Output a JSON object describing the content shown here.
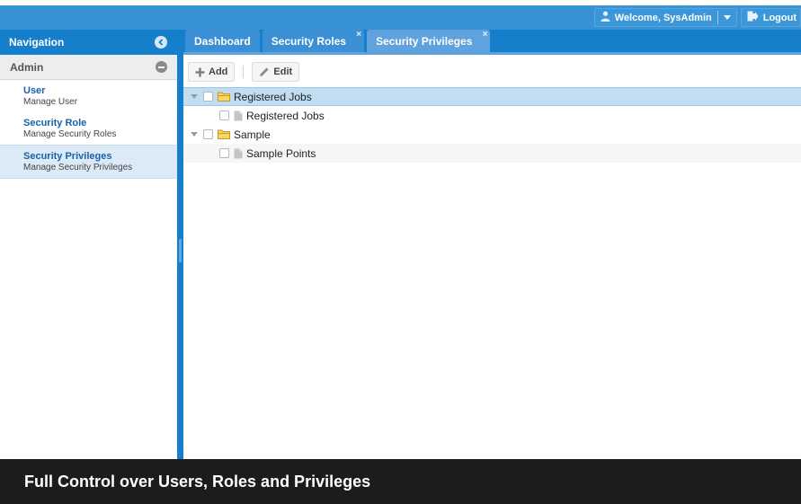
{
  "header": {
    "welcome_label": "Welcome, SysAdmin",
    "logout_label": "Logout",
    "accent_color": "#3892d3"
  },
  "sidebar": {
    "title": "Navigation",
    "group": "Admin",
    "items": [
      {
        "title": "User",
        "subtitle": "Manage User"
      },
      {
        "title": "Security Role",
        "subtitle": "Manage Security Roles"
      },
      {
        "title": "Security Privileges",
        "subtitle": "Manage Security Privileges",
        "selected": true
      }
    ]
  },
  "tabs": [
    {
      "label": "Dashboard",
      "closable": false
    },
    {
      "label": "Security Roles",
      "closable": true
    },
    {
      "label": "Security Privileges",
      "closable": true,
      "active": true
    }
  ],
  "tab_close_glyph": "×",
  "toolbar": {
    "add_label": "Add",
    "edit_label": "Edit"
  },
  "tree": [
    {
      "label": "Registered Jobs",
      "type": "folder",
      "level": 0,
      "expanded": true,
      "selected": true
    },
    {
      "label": "Registered Jobs",
      "type": "leaf",
      "level": 1
    },
    {
      "label": "Sample",
      "type": "folder",
      "level": 0,
      "expanded": true
    },
    {
      "label": "Sample Points",
      "type": "leaf",
      "level": 1
    }
  ],
  "caption": "Full Control over Users, Roles and Privileges",
  "icons": {
    "user": "user-icon",
    "logout": "logout-icon",
    "collapse": "chevron-left-icon",
    "group_collapse": "minus-icon",
    "add": "plus-icon",
    "edit": "pencil-icon",
    "folder": "folder-icon",
    "leaf": "document-icon"
  }
}
